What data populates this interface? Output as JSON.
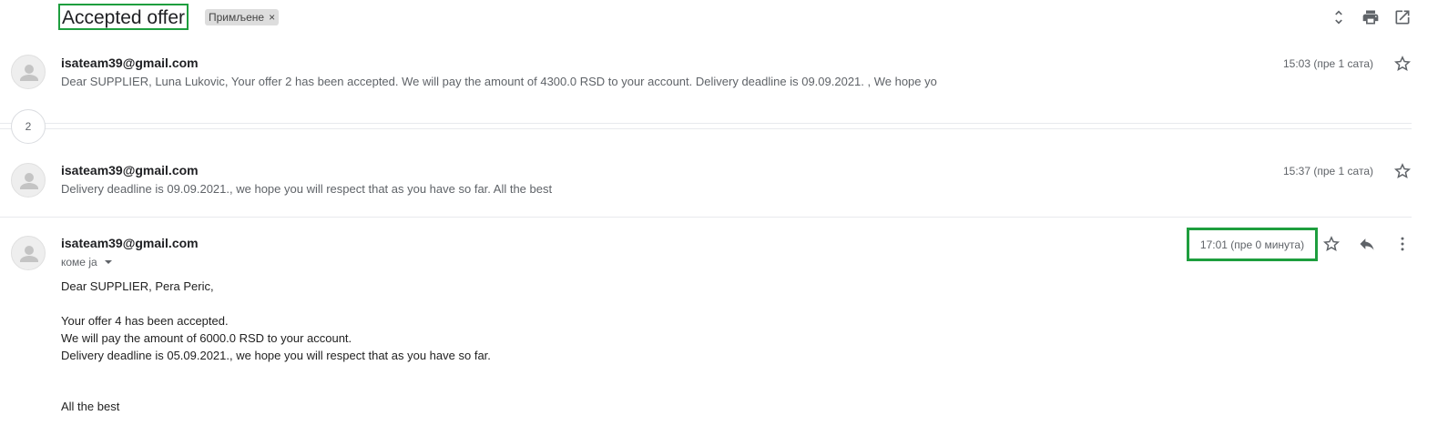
{
  "subject": "Accepted offer",
  "label": {
    "text": "Примљене",
    "remove": "×"
  },
  "header_icons": [
    "expand-collapse-icon",
    "print-icon",
    "open-new-window-icon"
  ],
  "messages": [
    {
      "sender": "isateam39@gmail.com",
      "time": "15:03 (пре 1 сата)",
      "snippet": "Dear SUPPLIER, Luna Lukovic, Your offer 2 has been accepted. We will pay the amount of 4300.0 RSD to your account. Delivery deadline is 09.09.2021. , We hope yo"
    },
    {
      "sender": "isateam39@gmail.com",
      "time": "15:37 (пре 1 сата)",
      "snippet": "Delivery deadline is 09.09.2021., we hope you will respect that as you have so far. All the best"
    }
  ],
  "collapsed_count": "2",
  "open_message": {
    "sender": "isateam39@gmail.com",
    "recipient": "коме ја",
    "time": "17:01 (пре 0 минута)",
    "body": {
      "greeting": "Dear SUPPLIER, Pera Peric,",
      "line1": "Your offer 4 has been accepted.",
      "line2": "We will pay the amount of 6000.0 RSD to your account.",
      "line3": "Delivery deadline is 05.09.2021., we hope you will respect that as you have so far.",
      "closing": "All the best"
    }
  },
  "colors": {
    "highlight": "#1e9e3e",
    "text_secondary": "#5f6368"
  }
}
